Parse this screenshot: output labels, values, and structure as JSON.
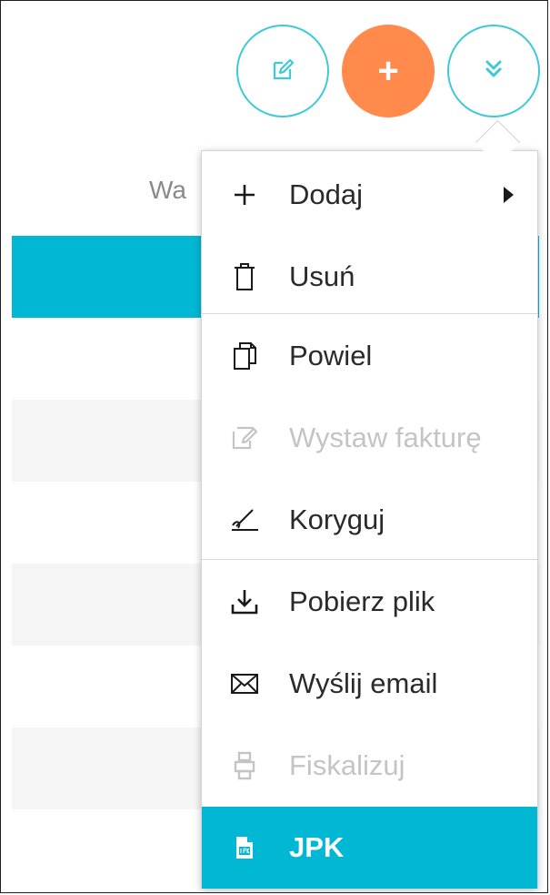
{
  "background": {
    "column_header_partial": "Wa"
  },
  "toolbar": {
    "edit_icon": "edit-icon",
    "add_label": "+",
    "more_icon": "double-chevron-down-icon"
  },
  "menu": {
    "items": [
      {
        "label": "Dodaj",
        "icon": "plus-icon",
        "has_submenu": true,
        "disabled": false
      },
      {
        "label": "Usuń",
        "icon": "trash-icon",
        "disabled": false
      },
      {
        "label": "Powiel",
        "icon": "duplicate-icon",
        "disabled": false
      },
      {
        "label": "Wystaw fakturę",
        "icon": "invoice-icon",
        "disabled": true
      },
      {
        "label": "Koryguj",
        "icon": "correct-icon",
        "disabled": false
      },
      {
        "label": "Pobierz plik",
        "icon": "download-icon",
        "disabled": false
      },
      {
        "label": "Wyślij email",
        "icon": "envelope-icon",
        "disabled": false
      },
      {
        "label": "Fiskalizuj",
        "icon": "printer-icon",
        "disabled": true
      },
      {
        "label": "JPK",
        "icon": "jpk-file-icon",
        "disabled": false,
        "active": true
      }
    ]
  },
  "colors": {
    "accent": "#00b8d4",
    "orange": "#ff8a4c",
    "outline": "#3ec9d9",
    "disabled_text": "#c4c4c4"
  }
}
